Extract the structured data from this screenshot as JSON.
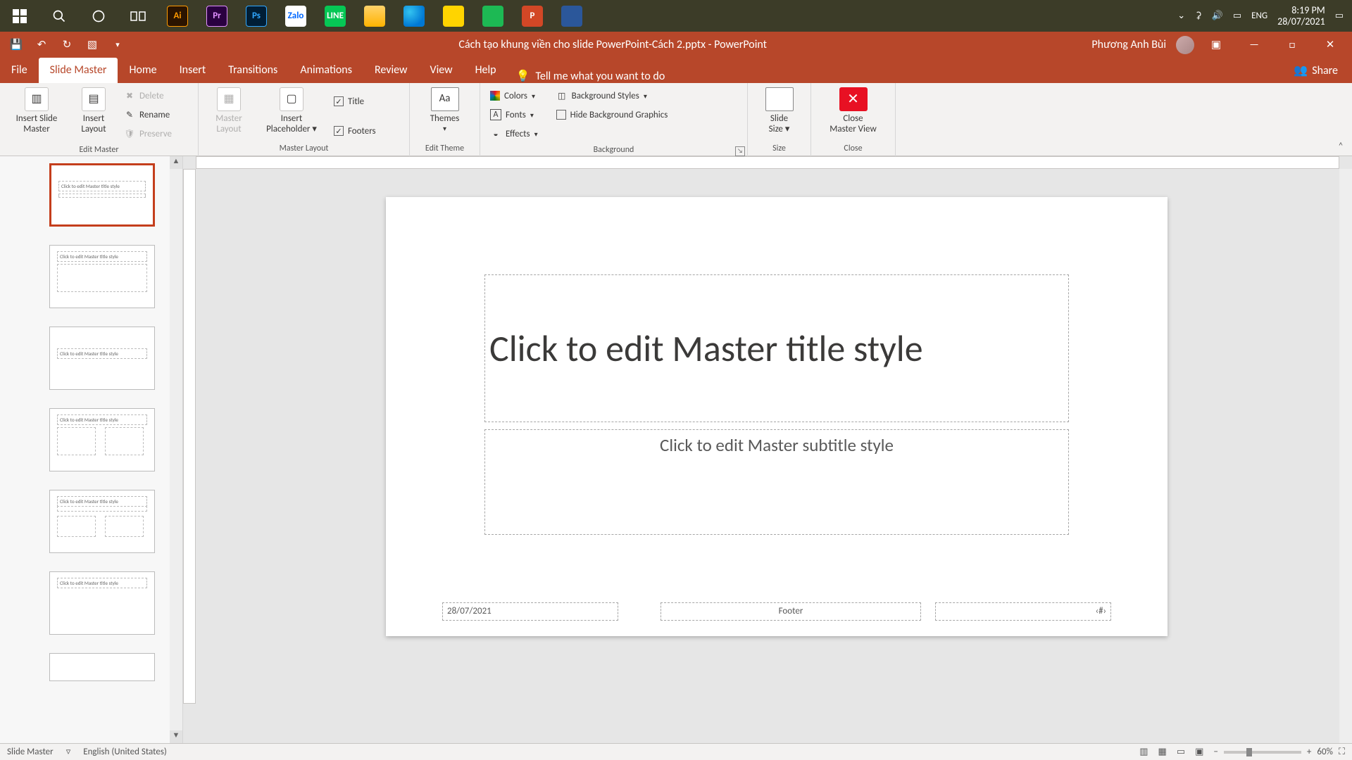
{
  "taskbar": {
    "lang": "ENG",
    "time": "8:19 PM",
    "date": "28/07/2021"
  },
  "titlebar": {
    "document": "Cách tạo khung viền cho slide PowerPoint-Cách 2.pptx  -  PowerPoint",
    "user": "Phương Anh Bùi"
  },
  "tabs": {
    "file": "File",
    "slide_master": "Slide Master",
    "home": "Home",
    "insert": "Insert",
    "transitions": "Transitions",
    "animations": "Animations",
    "review": "Review",
    "view": "View",
    "help": "Help",
    "tell_me": "Tell me what you want to do",
    "share": "Share"
  },
  "ribbon": {
    "edit_master": {
      "insert_slide_master": "Insert Slide\nMaster",
      "insert_layout": "Insert\nLayout",
      "delete": "Delete",
      "rename": "Rename",
      "preserve": "Preserve",
      "group": "Edit Master"
    },
    "master_layout": {
      "master_layout": "Master\nLayout",
      "insert_placeholder": "Insert\nPlaceholder",
      "title_chk": "Title",
      "footers_chk": "Footers",
      "group": "Master Layout"
    },
    "edit_theme": {
      "themes": "Themes",
      "group": "Edit Theme"
    },
    "background": {
      "colors": "Colors",
      "fonts": "Fonts",
      "effects": "Effects",
      "bg_styles": "Background Styles",
      "hide_bg": "Hide Background Graphics",
      "group": "Background"
    },
    "size": {
      "slide_size": "Slide\nSize",
      "group": "Size"
    },
    "close": {
      "close_master": "Close\nMaster View",
      "group": "Close"
    }
  },
  "thumbnails": {
    "master_text": "Click to edit Master title style"
  },
  "slide": {
    "title": "Click to edit Master title style",
    "subtitle": "Click to edit Master subtitle style",
    "date": "28/07/2021",
    "footer": "Footer",
    "num": "‹#›"
  },
  "status": {
    "mode": "Slide Master",
    "lang": "English (United States)",
    "zoom": "60%"
  }
}
